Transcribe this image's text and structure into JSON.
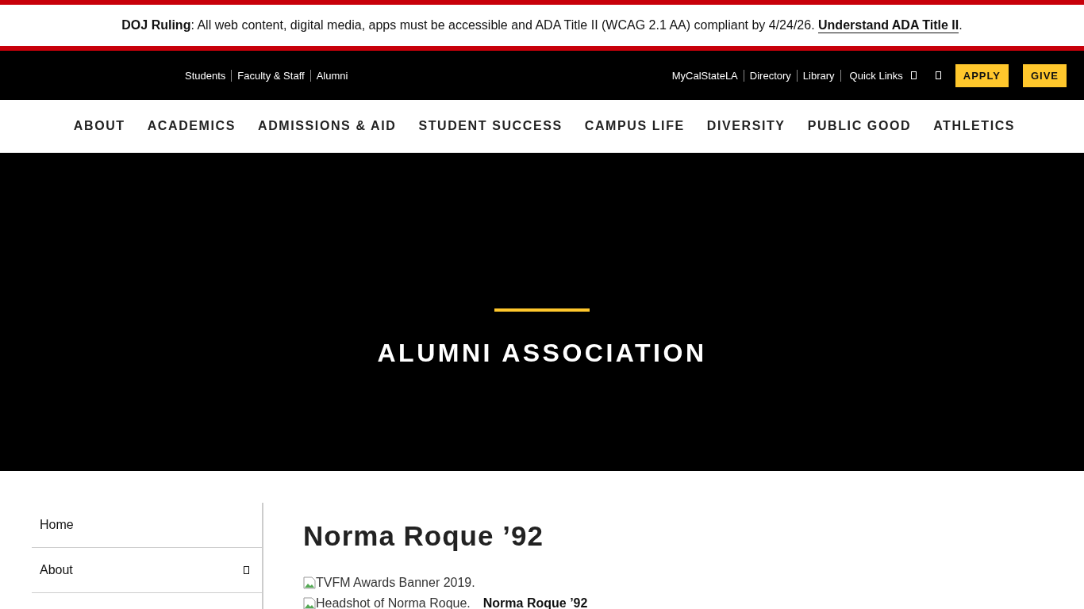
{
  "notice": {
    "text": "**DOJ Ruling**: All web content, digital media, apps must be accessible and ADA Title II (WCAG 2.1 AA) compliant by 4/24/26.",
    "link": "Understand ADA Title II",
    "suffix": "."
  },
  "audience_links": [
    "Students",
    "Faculty & Staff",
    "Alumni"
  ],
  "utility_links": [
    {
      "label": "MyCalStateLA",
      "kind": "link"
    },
    {
      "label": "Directory",
      "kind": "link"
    },
    {
      "label": "Library",
      "kind": "link"
    },
    {
      "label": "Quick Links",
      "kind": "menu"
    },
    {
      "kind": "search"
    }
  ],
  "action_buttons": [
    "APPLY",
    "GIVE"
  ],
  "main_nav": [
    "ABOUT",
    "ACADEMICS",
    "ADMISSIONS & AID",
    "STUDENT SUCCESS",
    "CAMPUS LIFE",
    "DIVERSITY",
    "PUBLIC GOOD",
    "ATHLETICS"
  ],
  "hero": {
    "title": "ALUMNI ASSOCIATION"
  },
  "sidebar": {
    "items": [
      {
        "label": "Home",
        "expandable": false
      },
      {
        "label": "About",
        "expandable": true
      }
    ]
  },
  "article": {
    "title": "Norma Roque ’92",
    "images": [
      {
        "alt": "TVFM Awards Banner 2019."
      },
      {
        "alt": "Headshot of Norma Roque.",
        "caption": "Norma Roque ’92"
      }
    ]
  }
}
